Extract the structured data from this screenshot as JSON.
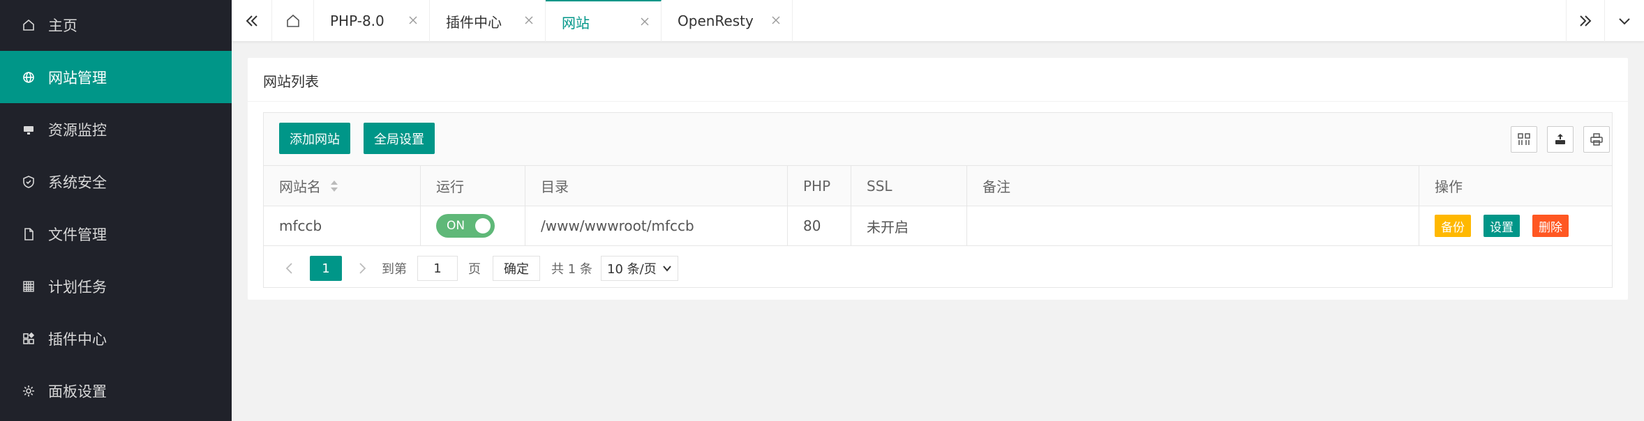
{
  "sidebar": {
    "items": [
      {
        "label": "主页",
        "icon": "home-icon"
      },
      {
        "label": "网站管理",
        "icon": "globe-icon",
        "active": true
      },
      {
        "label": "资源监控",
        "icon": "monitor-icon"
      },
      {
        "label": "系统安全",
        "icon": "shield-icon"
      },
      {
        "label": "文件管理",
        "icon": "file-icon"
      },
      {
        "label": "计划任务",
        "icon": "calendar-icon"
      },
      {
        "label": "插件中心",
        "icon": "plugin-icon"
      },
      {
        "label": "面板设置",
        "icon": "gear-icon"
      }
    ]
  },
  "tabs": [
    {
      "label": "PHP-8.0"
    },
    {
      "label": "插件中心"
    },
    {
      "label": "网站",
      "active": true
    },
    {
      "label": "OpenResty"
    }
  ],
  "card": {
    "title": "网站列表",
    "add_button": "添加网站",
    "global_button": "全局设置"
  },
  "table": {
    "headers": [
      "网站名",
      "运行",
      "目录",
      "PHP",
      "SSL",
      "备注",
      "操作"
    ],
    "rows": [
      {
        "name": "mfccb",
        "status": "ON",
        "path": "/www/wwwroot/mfccb",
        "php": "80",
        "ssl": "未开启",
        "note": "",
        "actions": [
          "备份",
          "设置",
          "删除"
        ]
      }
    ]
  },
  "pager": {
    "current": "1",
    "goto_label": "到第",
    "goto_value": "1",
    "page_label": "页",
    "confirm": "确定",
    "total": "共 1 条",
    "per_page": "10 条/页"
  },
  "colors": {
    "sidebar_bg": "#20222a",
    "accent": "#009688",
    "switch_on": "#5fb878",
    "backup": "#ffb800",
    "delete": "#ff5722"
  }
}
